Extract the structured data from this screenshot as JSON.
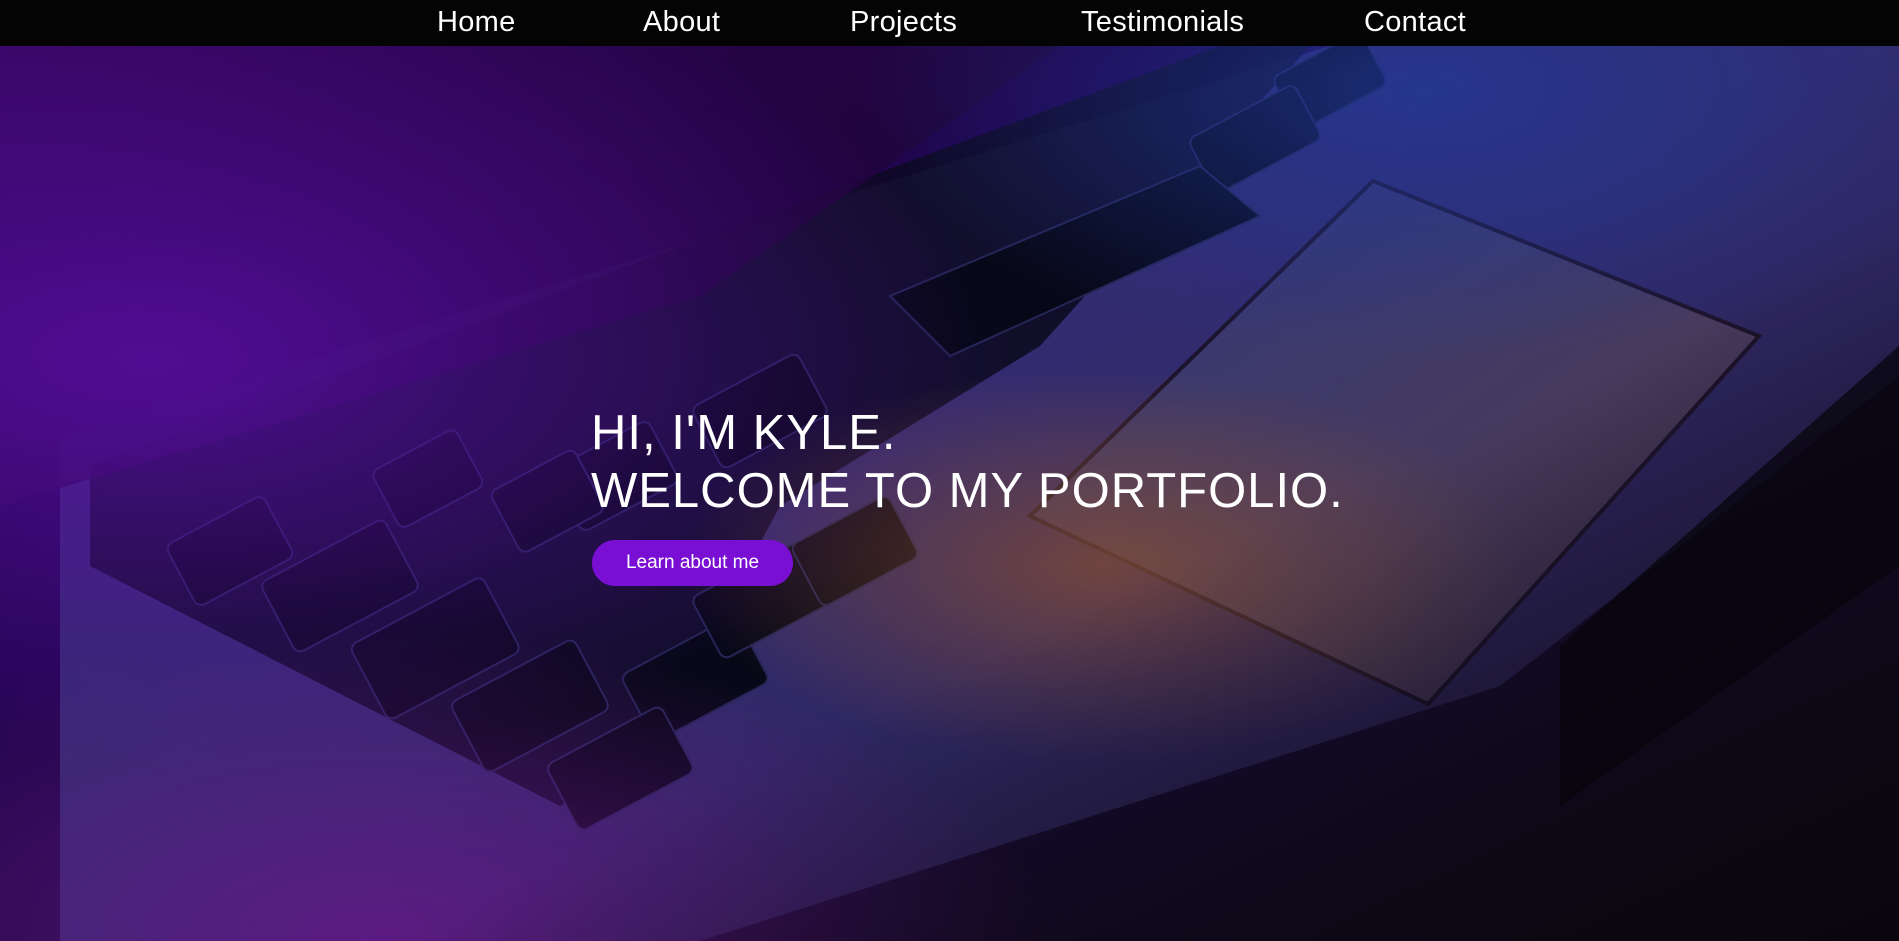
{
  "nav": {
    "items": [
      {
        "label": "Home"
      },
      {
        "label": "About"
      },
      {
        "label": "Projects"
      },
      {
        "label": "Testimonials"
      },
      {
        "label": "Contact"
      }
    ]
  },
  "hero": {
    "line1": "HI, I'M KYLE.",
    "line2": "WELCOME TO MY PORTFOLIO.",
    "button_label": "Learn about me"
  },
  "colors": {
    "nav_background": "#040404",
    "accent": "#7a0fd4",
    "text": "#ffffff"
  }
}
